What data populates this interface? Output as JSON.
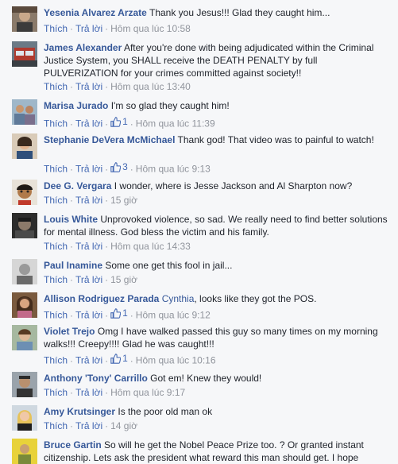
{
  "labels": {
    "like": "Thích",
    "reply": "Trả lời",
    "sep": "·"
  },
  "colors": {
    "link": "#365899",
    "action": "#4267b2",
    "meta": "#90949c",
    "background": "#f6f7f9"
  },
  "comments": [
    {
      "author": "Yesenia Alvarez Arzate",
      "text": "Thank you Jesus!!! Glad they caught him...",
      "time": "Hôm qua lúc 10:58",
      "likes": ""
    },
    {
      "author": "James Alexander",
      "text": "After you're done with being adjudicated within the Criminal Justice System, you SHALL receive the DEATH PENALTY by full PULVERIZATION for your crimes committed against society!!",
      "time": "Hôm qua lúc 13:40",
      "likes": ""
    },
    {
      "author": "Marisa Jurado",
      "text": "I'm so glad they caught him!",
      "time": "Hôm qua lúc 11:39",
      "likes": "1"
    },
    {
      "author": "Stephanie DeVera McMichael",
      "text": "Thank god! That video was to painful to watch!",
      "time": "Hôm qua lúc 9:13",
      "likes": "3"
    },
    {
      "author": "Dee G. Vergara",
      "text": "I wonder, where is Jesse Jackson and Al Sharpton now?",
      "time": "15 giờ",
      "likes": ""
    },
    {
      "author": "Louis White",
      "text": "Unprovoked violence, so sad. We really need to find better solutions for mental illness. God bless the victim and his family.",
      "time": "Hôm qua lúc 14:33",
      "likes": ""
    },
    {
      "author": "Paul Inamine",
      "text": "Some one get this fool in jail...",
      "time": "15 giờ",
      "likes": ""
    },
    {
      "author": "Allison Rodriguez Parada",
      "mention": "Cynthia",
      "text": ", looks like they got the POS.",
      "time": "Hôm qua lúc 9:12",
      "likes": "1"
    },
    {
      "author": "Violet Trejo",
      "text": "Omg I have walked passed this guy so many times on my morning walks!!! Creepy!!!! Glad he was caught!!!",
      "time": "Hôm qua lúc 10:16",
      "likes": "1"
    },
    {
      "author": "Anthony 'Tony' Carrillo",
      "text": "Got em! Knew they would!",
      "time": "Hôm qua lúc 9:17",
      "likes": ""
    },
    {
      "author": "Amy Krutsinger",
      "text": "Is the poor old man ok",
      "time": "14 giờ",
      "likes": ""
    },
    {
      "author": "Bruce Gartin",
      "text": "So will he get the Nobel Peace Prize too. ? Or granted instant citizenship. Lets ask the president what reward this man should get. I hope",
      "time": "",
      "likes": ""
    }
  ]
}
